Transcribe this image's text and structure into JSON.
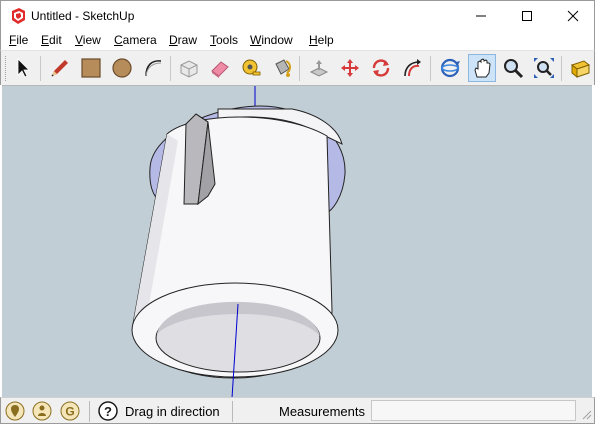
{
  "window": {
    "title": "Untitled - SketchUp",
    "app_icon": "sketchup-logo-icon",
    "controls": [
      "minimize-icon",
      "maximize-icon",
      "close-icon"
    ]
  },
  "menu": [
    {
      "underline": "F",
      "rest": "ile"
    },
    {
      "underline": "E",
      "rest": "dit"
    },
    {
      "underline": "V",
      "rest": "iew"
    },
    {
      "underline": "C",
      "rest": "amera"
    },
    {
      "underline": "D",
      "rest": "raw"
    },
    {
      "underline": "T",
      "rest": "ools"
    },
    {
      "underline": "W",
      "rest": "indow"
    },
    {
      "underline": "H",
      "rest": "elp"
    }
  ],
  "toolbar": {
    "tools": [
      "select-icon",
      "line-pencil-icon",
      "rectangle-icon",
      "circle-icon",
      "arc-icon",
      "make-component-icon",
      "eraser-icon",
      "tape-measure-icon",
      "paint-bucket-icon",
      "push-pull-icon",
      "move-icon",
      "rotate-icon",
      "follow-me-icon",
      "orbit-icon",
      "pan-icon",
      "zoom-icon",
      "zoom-extents-icon",
      "warehouse-icon"
    ],
    "active_tool": "pan-icon"
  },
  "statusbar": {
    "geo_icons": [
      "geo-location-icon",
      "credits-icon",
      "user-account-icon"
    ],
    "help_icon": "instructor-help-icon",
    "hint": "Drag in direction",
    "measurements_label": "Measurements",
    "measurements_value": ""
  },
  "colors": {
    "viewport_bg": "#c2ced5",
    "model_face": "#f7f7f9",
    "model_shadow": "#d9d9df",
    "back_face": "#b5b9e6",
    "active_tool_bg": "#cde3f7",
    "axis_blue": "#0000d0"
  }
}
